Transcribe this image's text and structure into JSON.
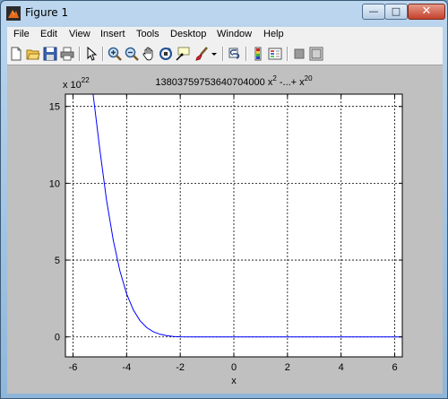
{
  "window": {
    "title": "Figure 1"
  },
  "menu": [
    "File",
    "Edit",
    "View",
    "Insert",
    "Tools",
    "Desktop",
    "Window",
    "Help"
  ],
  "controls": {
    "minimize": "—",
    "maximize": "□",
    "close": "✕"
  },
  "toolbar": [
    "new-figure",
    "open-file",
    "save",
    "print",
    "edit-plot",
    "zoom-in",
    "zoom-out",
    "pan",
    "rotate-3d",
    "data-cursor",
    "brush",
    "link-plot",
    "colorbar",
    "legend",
    "hide-plot-tools",
    "show-plot-tools"
  ],
  "chart_data": {
    "type": "line",
    "title": "13803759753640704000 x",
    "title_exp1": "2",
    "title_mid": " -...+ x",
    "title_exp2": "20",
    "xlabel": "x",
    "ylabel": "",
    "y_multiplier": "x 10",
    "y_multiplier_exp": "22",
    "xlim": [
      -6.283,
      6.283
    ],
    "ylim": [
      -1.3,
      15.8
    ],
    "xticks": [
      -6,
      -4,
      -2,
      0,
      2,
      4,
      6
    ],
    "yticks": [
      0,
      5,
      10,
      15
    ],
    "grid": true,
    "series": [
      {
        "color": "#0000ff",
        "x": [
          -5.25,
          -5.0,
          -4.75,
          -4.5,
          -4.25,
          -4.0,
          -3.75,
          -3.5,
          -3.25,
          -3.0,
          -2.75,
          -2.5,
          -2.25,
          -2.0,
          -1.5,
          -1.0,
          0,
          2,
          4,
          6.283
        ],
        "y": [
          15.8,
          12.2,
          8.9,
          6.3,
          4.3,
          2.8,
          1.75,
          1.05,
          0.6,
          0.33,
          0.17,
          0.08,
          0.03,
          0.01,
          0,
          0,
          0,
          0,
          0,
          0
        ]
      }
    ]
  }
}
